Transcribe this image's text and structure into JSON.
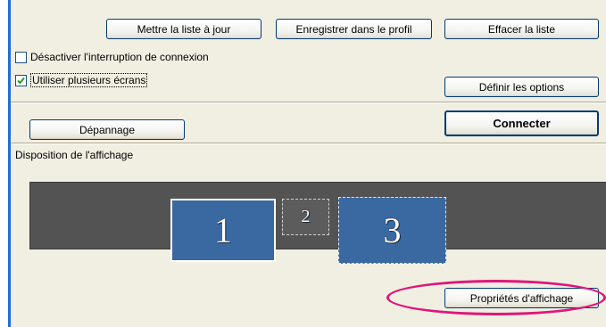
{
  "toolbar": {
    "update_label": "Mettre la liste à jour",
    "save_label": "Enregistrer dans le profil",
    "clear_label": "Effacer la liste"
  },
  "options": {
    "disable_reconnect": {
      "label": "Désactiver l'interruption de connexion",
      "checked": false
    },
    "multi_monitor": {
      "label": "Utiliser plusieurs écrans",
      "checked": true
    },
    "set_options_label": "Définir les options"
  },
  "actions": {
    "troubleshoot_label": "Dépannage",
    "connect_label": "Connecter"
  },
  "display_layout": {
    "title": "Disposition de l'affichage",
    "monitors": [
      {
        "number": "1",
        "state": "selected"
      },
      {
        "number": "2",
        "state": "inactive"
      },
      {
        "number": "3",
        "state": "active"
      }
    ],
    "properties_label": "Propriétés d'affichage"
  },
  "colors": {
    "accent_highlight": "#e0167a",
    "monitor_fill": "#3a69a1",
    "panel_bg": "#f1efe2"
  }
}
